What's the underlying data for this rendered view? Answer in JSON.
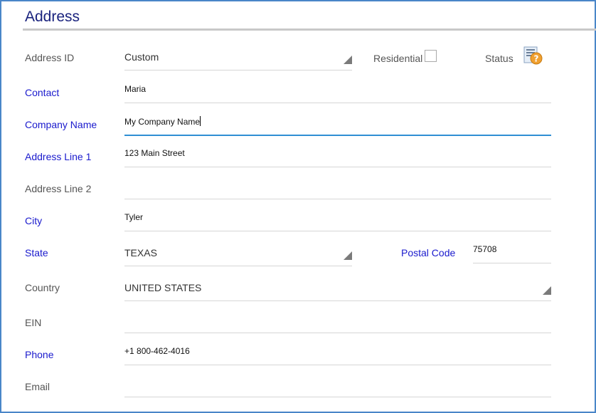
{
  "header": {
    "title": "Address"
  },
  "form": {
    "address_id": {
      "label": "Address ID",
      "value": "Custom"
    },
    "residential": {
      "label": "Residential",
      "checked": false
    },
    "status": {
      "label": "Status",
      "icon": "status-help-icon"
    },
    "contact": {
      "label": "Contact",
      "value": "Maria"
    },
    "company_name": {
      "label": "Company Name",
      "value": "My Company Name"
    },
    "address_line_1": {
      "label": "Address Line 1",
      "value": "123 Main Street"
    },
    "address_line_2": {
      "label": "Address Line 2",
      "value": ""
    },
    "city": {
      "label": "City",
      "value": "Tyler"
    },
    "state": {
      "label": "State",
      "value": "TEXAS"
    },
    "postal_code": {
      "label": "Postal Code",
      "value": "75708"
    },
    "country": {
      "label": "Country",
      "value": "UNITED STATES"
    },
    "ein": {
      "label": "EIN",
      "value": ""
    },
    "phone": {
      "label": "Phone",
      "value": "+1 800-462-4016"
    },
    "email": {
      "label": "Email",
      "value": ""
    }
  },
  "colors": {
    "title": "#1a237e",
    "required_label": "#1a1acd",
    "optional_label": "#555555",
    "frame_border": "#4a86c8",
    "focus_underline": "#2f8fd4"
  }
}
